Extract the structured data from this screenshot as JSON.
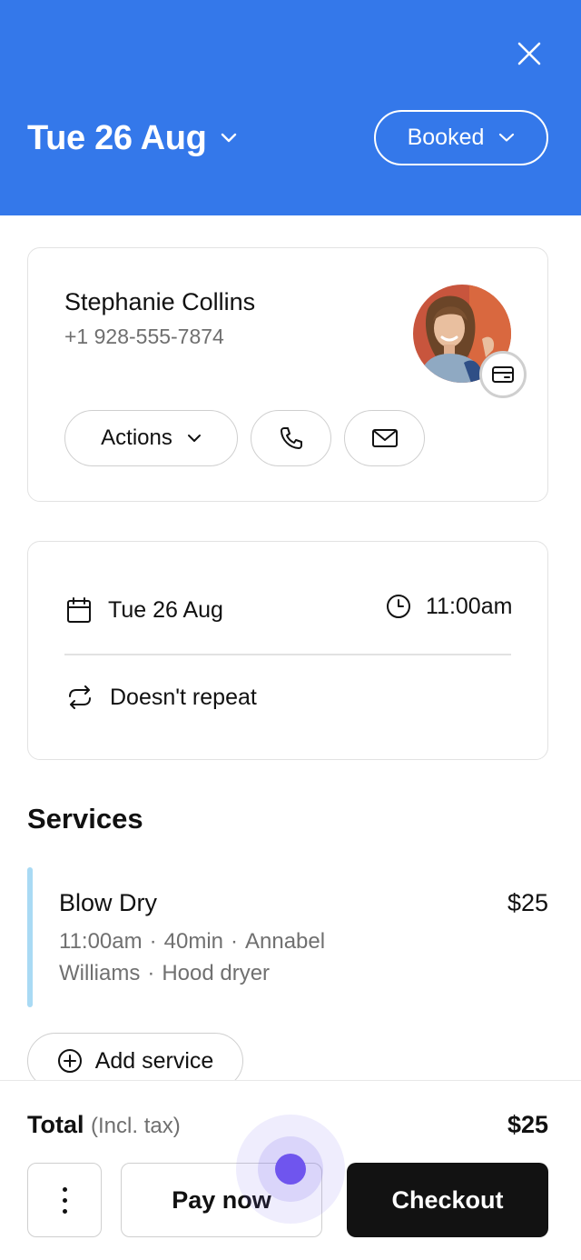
{
  "header": {
    "date": "Tue 26 Aug",
    "status": "Booked",
    "background_color": "#3478ea",
    "close_icon": "close-icon"
  },
  "client": {
    "name": "Stephanie Collins",
    "phone": "+1 928-555-7874",
    "actions_label": "Actions",
    "call_icon": "phone-icon",
    "mail_icon": "mail-icon",
    "badge_icon": "card-icon"
  },
  "schedule": {
    "date": "Tue 26 Aug",
    "time": "11:00am",
    "repeat": "Doesn't repeat"
  },
  "services": {
    "title": "Services",
    "items": [
      {
        "name": "Blow Dry",
        "price": "$25",
        "time": "11:00am",
        "duration": "40min",
        "staff": "Annabel Williams",
        "resource": "Hood dryer",
        "bar_color": "#a9daf4"
      }
    ],
    "add_label": "Add service"
  },
  "footer": {
    "total_label": "Total",
    "total_note": "(Incl. tax)",
    "total_amount": "$25",
    "pay_label": "Pay now",
    "checkout_label": "Checkout"
  }
}
